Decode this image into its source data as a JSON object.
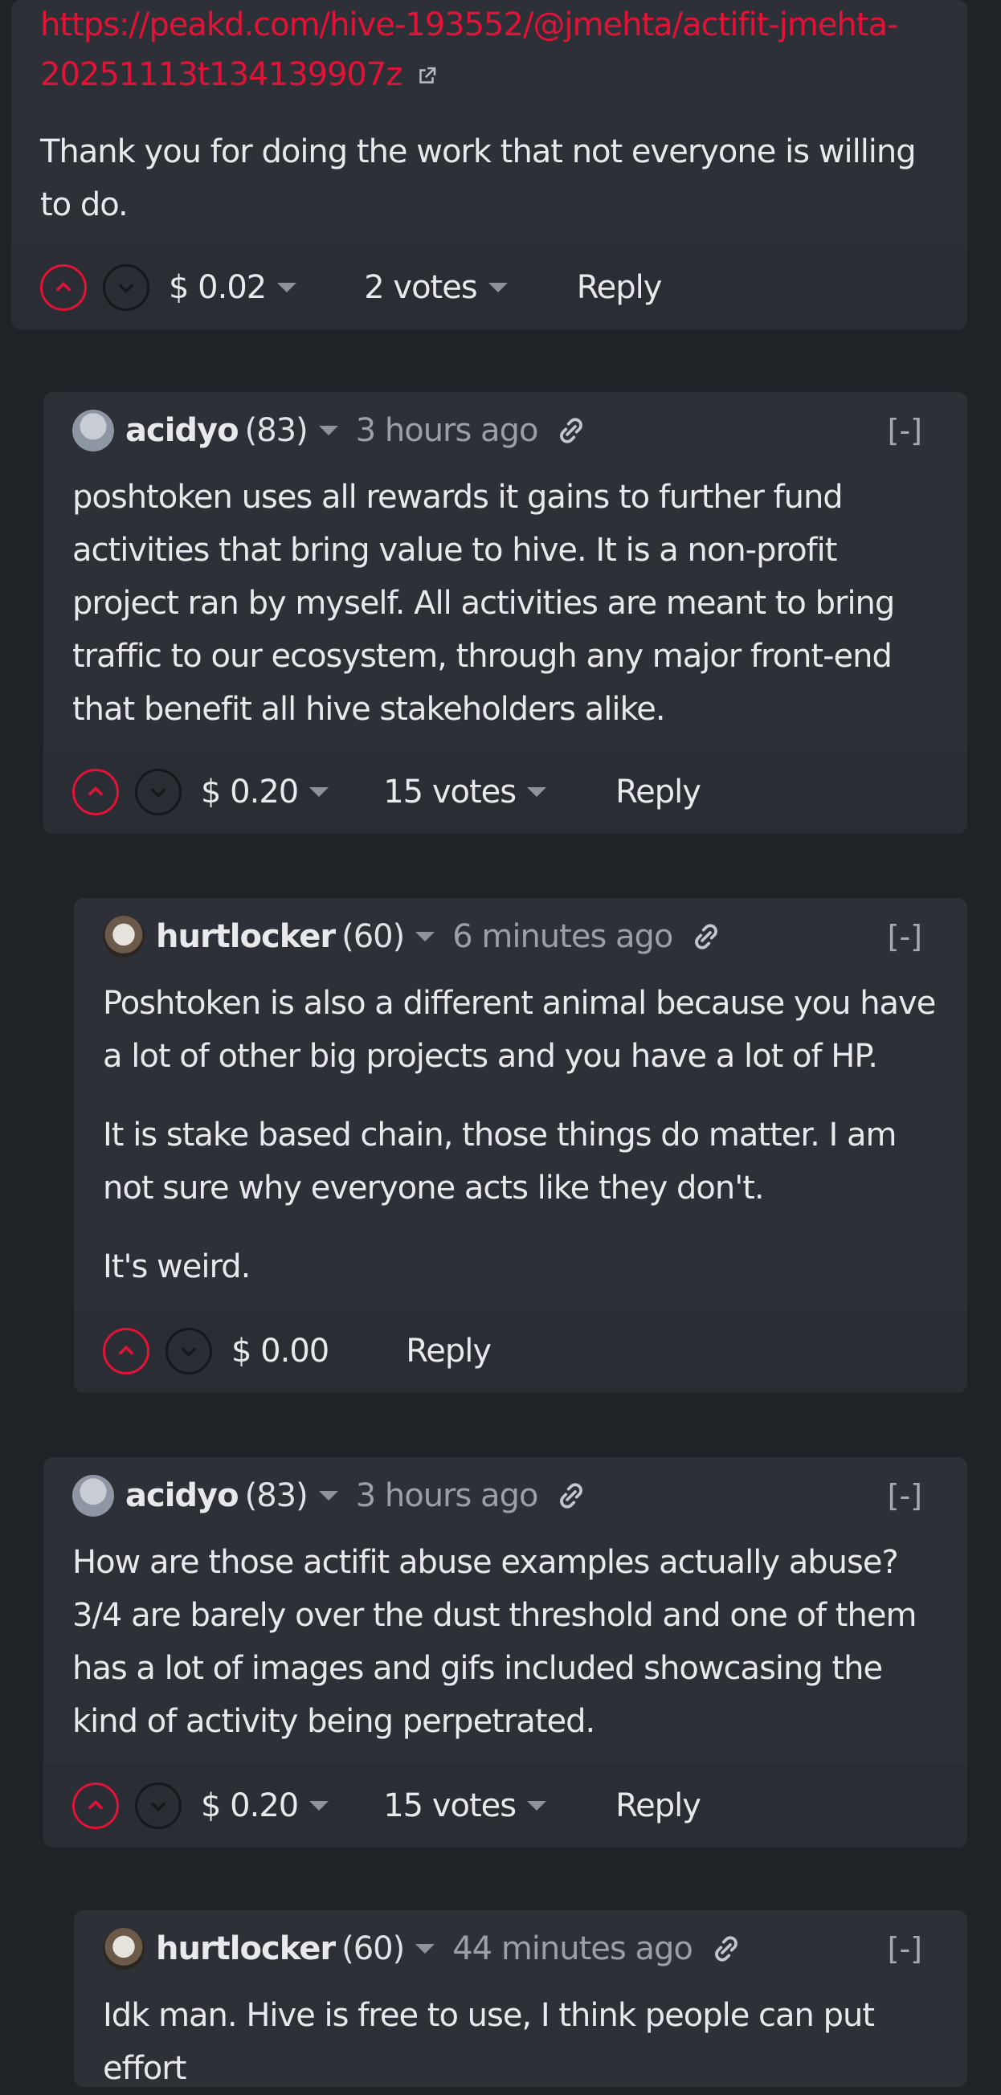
{
  "top_comment": {
    "url_line1": "https://peakd.com/hive-193552/@jmehta/actifit-jmehta-",
    "url_line2": "20251113t134139907z",
    "text": "Thank you for doing the work that not everyone is willing to do.",
    "payout": "$ 0.02",
    "votes": "2 votes",
    "reply": "Reply"
  },
  "comments": [
    {
      "author": "acidyo",
      "rep": "(83)",
      "time": "3 hours ago",
      "collapse": "[-]",
      "paragraphs": [
        "poshtoken uses all rewards it gains to further fund activities that bring value to hive. It is a non-profit project ran by myself. All activities are meant to bring traffic to our ecosystem, through any major front-end that benefit all hive stakeholders alike."
      ],
      "payout": "$ 0.20",
      "votes": "15 votes",
      "reply": "Reply"
    },
    {
      "author": "hurtlocker",
      "rep": "(60)",
      "time": "6 minutes ago",
      "collapse": "[-]",
      "paragraphs": [
        "Poshtoken is also a different animal because you have a lot of other big projects and you have a lot of HP.",
        "It is stake based chain, those things do matter. I am not sure why everyone acts like they don't.",
        "It's weird."
      ],
      "payout": "$ 0.00",
      "reply": "Reply"
    },
    {
      "author": "acidyo",
      "rep": "(83)",
      "time": "3 hours ago",
      "collapse": "[-]",
      "paragraphs": [
        "How are those actifit abuse examples actually abuse? 3/4 are barely over the dust threshold and one of them has a lot of images and gifs included showcasing the kind of activity being perpetrated."
      ],
      "payout": "$ 0.20",
      "votes": "15 votes",
      "reply": "Reply"
    },
    {
      "author": "hurtlocker",
      "rep": "(60)",
      "time": "44 minutes ago",
      "collapse": "[-]",
      "paragraphs": [
        "Idk man. Hive is free to use, I think people can put effort"
      ]
    }
  ]
}
